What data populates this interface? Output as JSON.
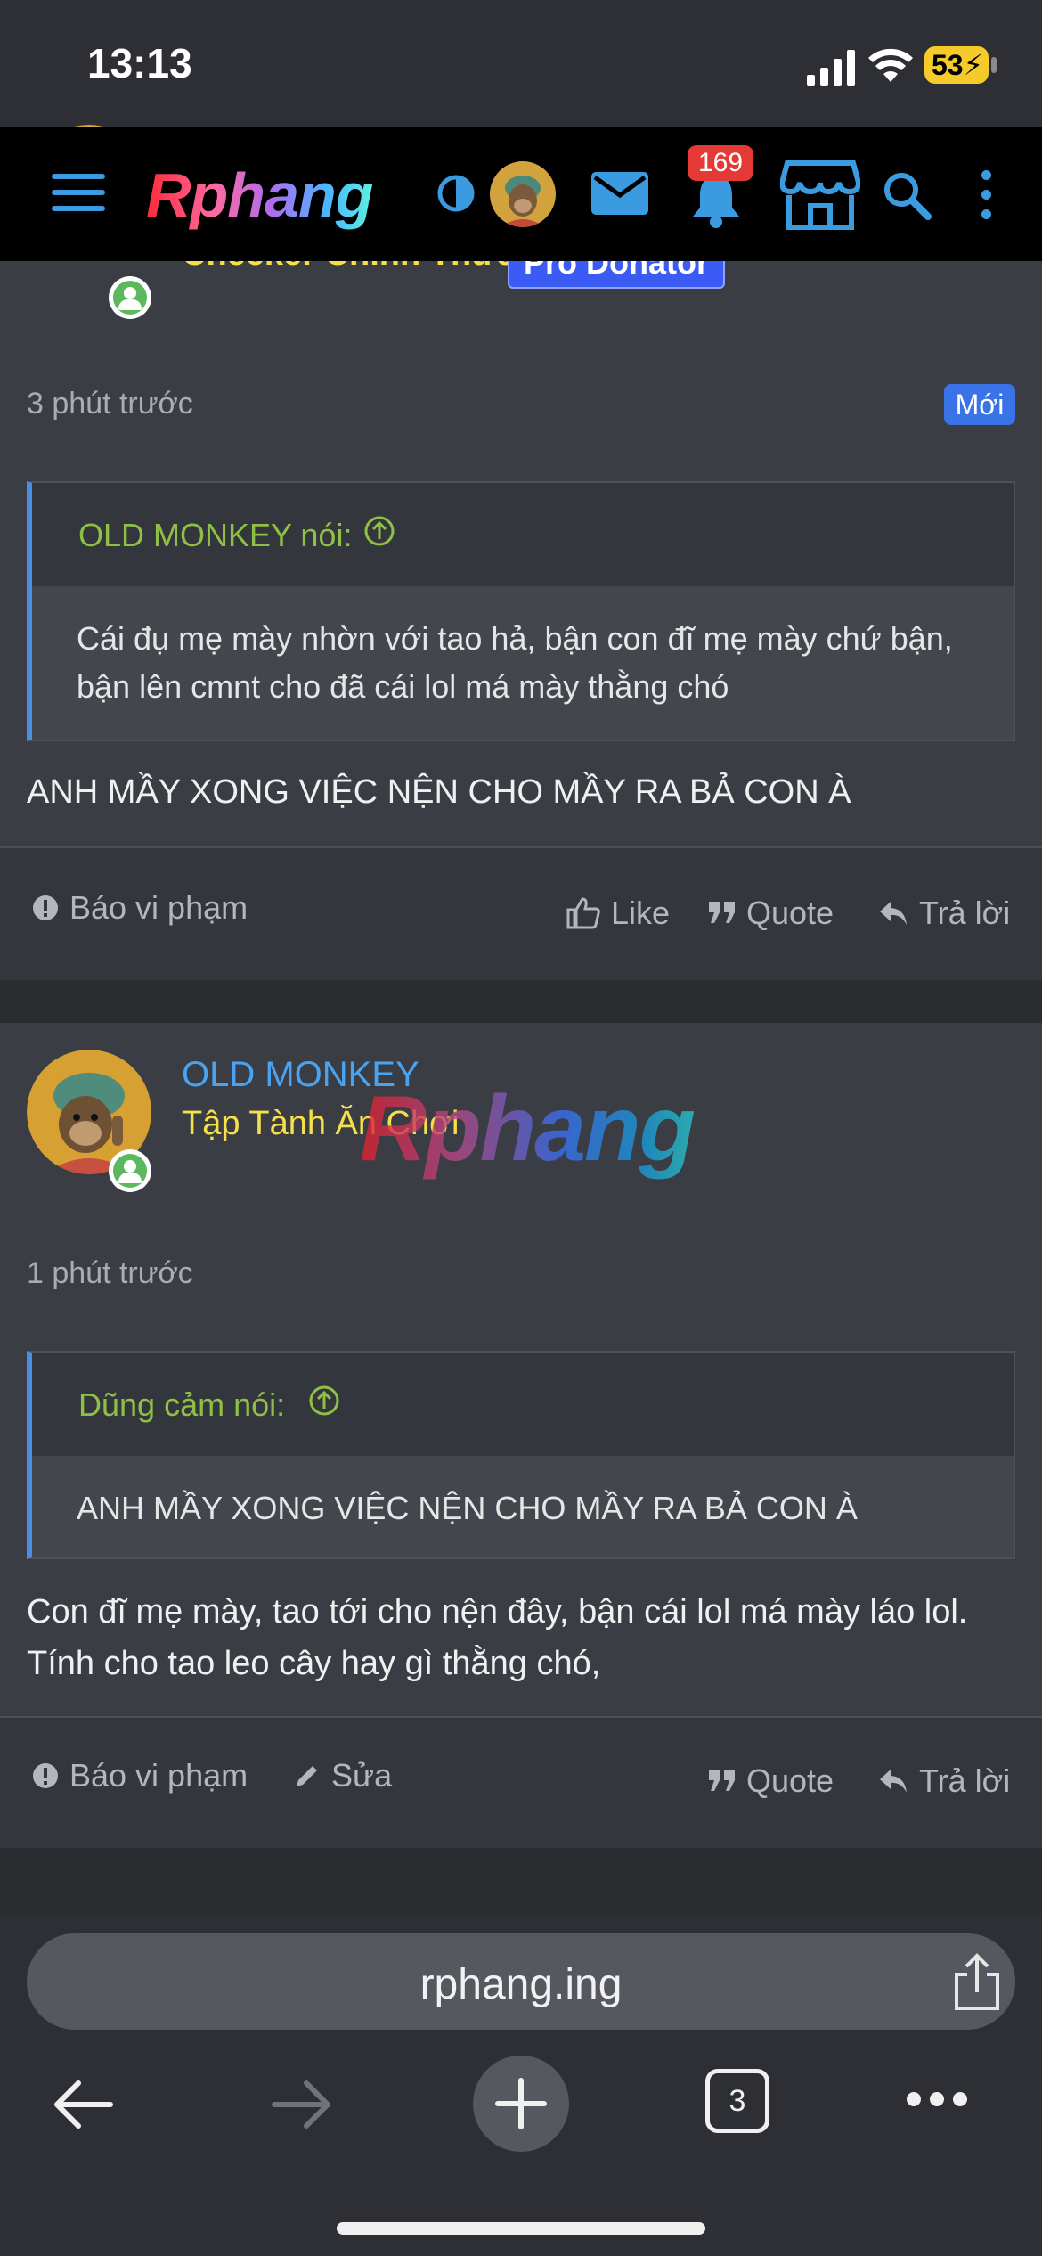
{
  "status_bar": {
    "time": "13:13",
    "battery": "53"
  },
  "nav": {
    "logo": "Rphang",
    "notification_count": "169"
  },
  "post1": {
    "user_title": "Checker Chính Thức",
    "badge": "Pro Donator",
    "time": "3 phút trước",
    "new_badge": "Mới",
    "quote": {
      "author": "OLD MONKEY nói:",
      "text": "Cái đụ mẹ mày nhờn với tao hả, bận con đĩ mẹ mày chứ bận, bận lên cmnt cho đã cái lol má mày thằng chó"
    },
    "text": "ANH MẦY XONG VIỆC NỆN CHO MẦY RA BẢ CON À",
    "actions": {
      "report": "Báo vi phạm",
      "like": "Like",
      "quote": "Quote",
      "reply": "Trả lời"
    }
  },
  "post2": {
    "username": "OLD MONKEY",
    "user_title": "Tập Tành Ăn Chơi",
    "time": "1 phút trước",
    "quote": {
      "author": "Dũng cảm nói:",
      "text": "ANH MẦY XONG VIỆC NỆN CHO MẦY RA BẢ CON À"
    },
    "text": "Con đĩ mẹ mày, tao tới cho nện đây, bận cái lol má mày láo lol. Tính cho tao leo cây hay gì thằng chó,",
    "actions": {
      "report": "Báo vi phạm",
      "edit": "Sửa",
      "quote": "Quote",
      "reply": "Trả lời"
    }
  },
  "watermark": "Rphang",
  "browser": {
    "url": "rphang.ing",
    "tab_count": "3"
  },
  "colors": {
    "accent": "#3a9be0",
    "quote_author": "#8fc045",
    "user_title": "#f5e04a",
    "username": "#4aa3f0"
  }
}
